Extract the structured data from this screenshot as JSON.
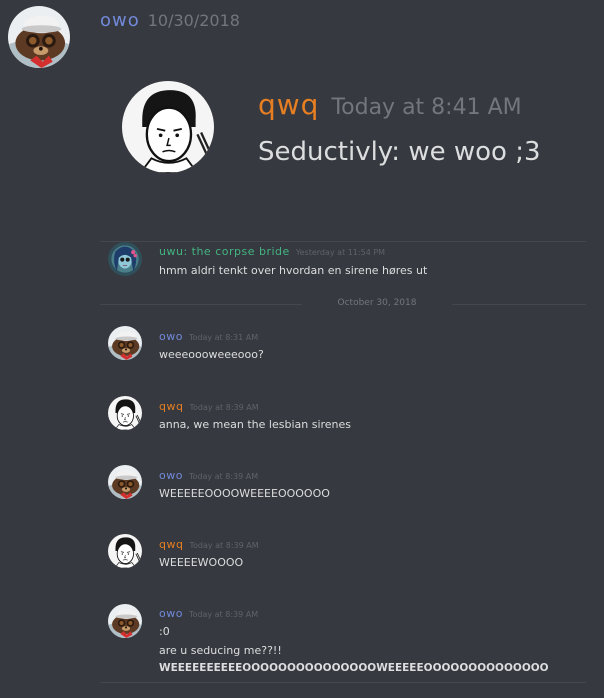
{
  "outer_message": {
    "author": "owo",
    "timestamp": "10/30/2018",
    "avatar": "otter-pilot-avatar"
  },
  "quoted_screenshot": {
    "author": "qwq",
    "timestamp": "Today at 8:41 AM",
    "text": "Seductivly: we woo ;3",
    "avatar": "sketch-face-avatar"
  },
  "chat": {
    "messages": [
      {
        "author": "uwu: the corpse bride",
        "timestamp": "Yesterday at 11:54 PM",
        "lines": [
          "hmm aldri tenkt over hvordan en sirene høres ut"
        ],
        "author_color": "#43b581",
        "avatar": "corpse-bride-avatar"
      },
      {
        "author": "owo",
        "timestamp": "Today at 8:31 AM",
        "lines": [
          "weeeoooweeeooo?"
        ],
        "author_color": "#7289da",
        "avatar": "otter-pilot-avatar"
      },
      {
        "author": "qwq",
        "timestamp": "Today at 8:39 AM",
        "lines": [
          "anna, we mean the lesbian sirenes"
        ],
        "author_color": "#e67e22",
        "avatar": "sketch-face-avatar"
      },
      {
        "author": "owo",
        "timestamp": "Today at 8:39 AM",
        "lines": [
          "WEEEEEOOOOWEEEEOOOOOO"
        ],
        "author_color": "#7289da",
        "avatar": "otter-pilot-avatar"
      },
      {
        "author": "qwq",
        "timestamp": "Today at 8:39 AM",
        "lines": [
          "WEEEEWOOOO"
        ],
        "author_color": "#e67e22",
        "avatar": "sketch-face-avatar"
      },
      {
        "author": "owo",
        "timestamp": "Today at 8:39 AM",
        "lines": [
          ":0",
          "are u seducing me??!!",
          "WEEEEEEEEEEOOOOOOOOOOOOOOOWEEEEEOOOOOOOOOOOOOO"
        ],
        "author_color": "#7289da",
        "avatar": "otter-pilot-avatar"
      }
    ],
    "date_divider": "October 30, 2018"
  },
  "colors": {
    "background": "#36393f",
    "owo": "#7289da",
    "qwq": "#e67e22",
    "uwu": "#43b581",
    "timestamp": "#72767d"
  }
}
